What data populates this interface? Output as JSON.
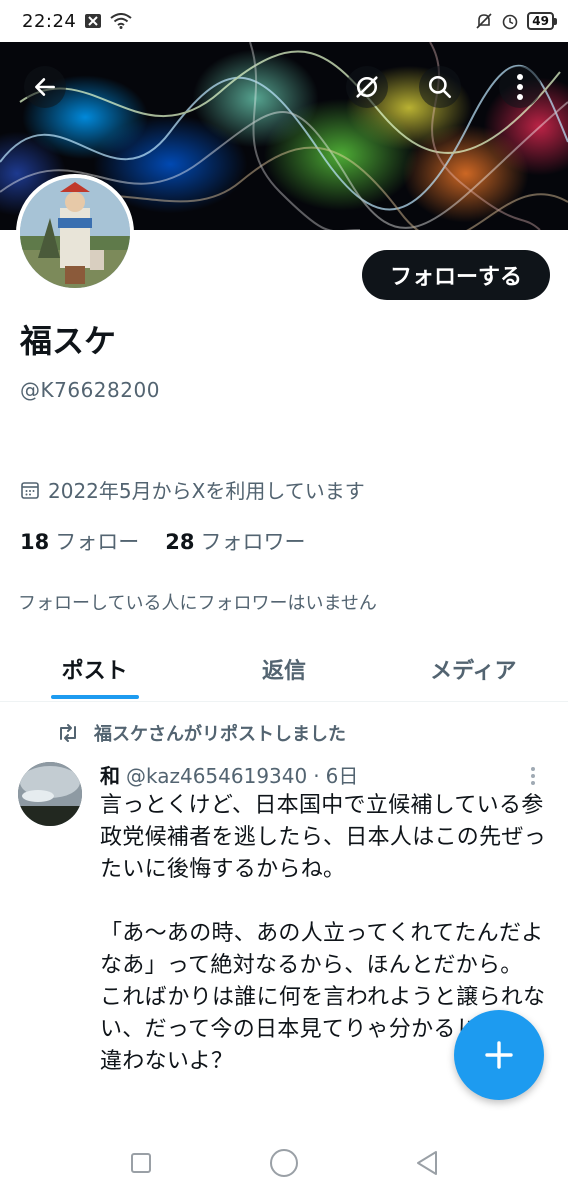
{
  "status_bar": {
    "time": "22:24",
    "battery": "49",
    "left_icons": [
      "notification-x-icon",
      "wifi-icon"
    ],
    "right_icons": [
      "bell-muted-icon",
      "alarm-icon",
      "battery-icon"
    ]
  },
  "header": {
    "back_icon": "arrow-left-icon",
    "actions": [
      "no-sync-icon",
      "search-icon",
      "more-vertical-icon"
    ]
  },
  "profile": {
    "follow_label": "フォローする",
    "display_name": "福スケ",
    "handle": "@K76628200",
    "joined": "2022年5月からXを利用しています",
    "following_count": "18",
    "following_label": "フォロー",
    "followers_count": "28",
    "followers_label": "フォロワー",
    "no_mutual": "フォローしている人にフォロワーはいません"
  },
  "tabs": [
    {
      "label": "ポスト",
      "active": true
    },
    {
      "label": "返信",
      "active": false
    },
    {
      "label": "メディア",
      "active": false
    }
  ],
  "tweet": {
    "repost_by": "福スケさんがリポストしました",
    "author_name": "和",
    "author_handle": "@kaz4654619340",
    "time": "6日",
    "separator": "·",
    "text": "言っとくけど、日本国中で立候補している参政党候補者を逃したら、日本人はこの先ぜったいに後悔するからね。\n\n「あ〜あの時、あの人立ってくれてたんだよなあ」って絶対なるから、ほんとだから。\nこればかりは誰に何を言われようと譲られない、だって今の日本見てりゃ分かるじゃん。違わないよ？"
  },
  "fab": {
    "icon": "plus-icon"
  },
  "nav": [
    "recents-square-icon",
    "home-circle-icon",
    "back-triangle-icon"
  ],
  "colors": {
    "accent": "#1d9bf0",
    "text": "#0f1419",
    "secondary": "#536471",
    "follow_bg": "#0f1419"
  }
}
